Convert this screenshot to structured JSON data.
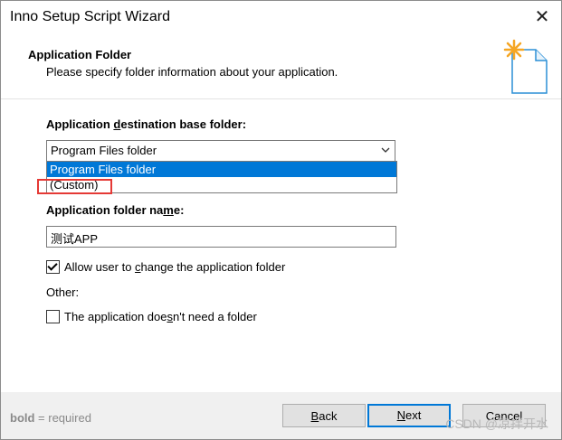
{
  "window": {
    "title": "Inno Setup Script Wizard",
    "close_glyph": "✕"
  },
  "header": {
    "title": "Application Folder",
    "subtitle": "Please specify folder information about your application.",
    "icon": "wizard-star-document-icon"
  },
  "form": {
    "base_folder_label_pre": "Application ",
    "base_folder_label_u": "d",
    "base_folder_label_post": "estination base folder:",
    "base_folder_selected": "Program Files folder",
    "base_folder_options": [
      "Program Files folder",
      "(Custom)"
    ],
    "folder_name_label_pre": "Application folder na",
    "folder_name_label_u": "m",
    "folder_name_label_post": "e:",
    "folder_name_value": "测试APP",
    "allow_change_pre": "Allow user to ",
    "allow_change_u": "c",
    "allow_change_post": "hange the application folder",
    "allow_change_checked": true,
    "other_label": "Other:",
    "no_folder_pre": "The application doe",
    "no_folder_u": "s",
    "no_folder_post": "n't need a folder",
    "no_folder_checked": false
  },
  "footer": {
    "required_hint_bold": "bold",
    "required_hint_rest": " = required",
    "back_u": "B",
    "back_rest": "ack",
    "next_u": "N",
    "next_rest": "ext",
    "cancel_label": "Cancel",
    "watermark": "CSDN @凉拌开水"
  },
  "colors": {
    "selection": "#0078d7",
    "highlight_box": "#e53935",
    "icon_star": "#f5a623"
  }
}
